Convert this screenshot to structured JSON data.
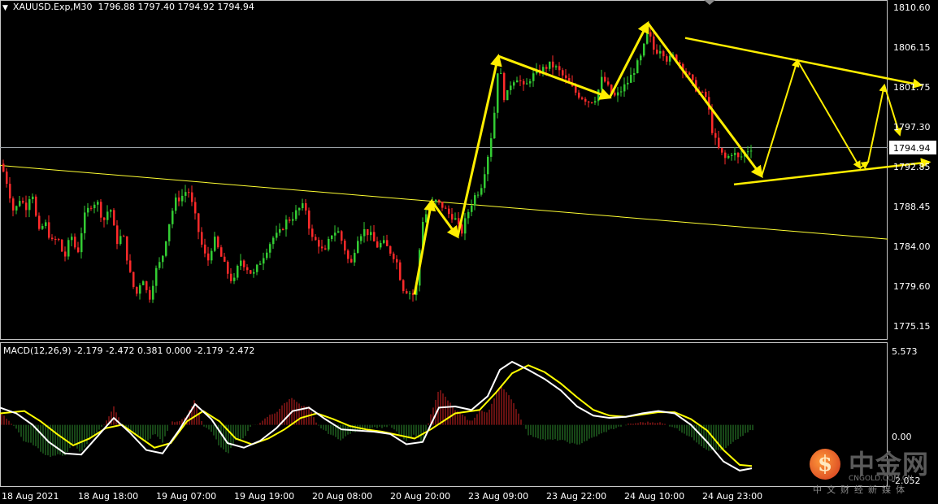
{
  "header": {
    "collapse_icon": "triangle-down-icon",
    "symbol_info": "XAUUSD.Exp,M30",
    "ohlc": "1796.88 1797.40 1794.92 1794.94"
  },
  "macd_header": {
    "label": "MACD(12,26,9) -2.179 -2.472 0.381 0.000 -2.179 -2.472"
  },
  "price_axis": {
    "ticks": [
      "1810.60",
      "1806.15",
      "1801.75",
      "1797.30",
      "1792.85",
      "1788.45",
      "1784.00",
      "1779.60",
      "1775.15"
    ],
    "current_price": "1794.94"
  },
  "macd_axis": {
    "ticks": [
      "5.573",
      "0.00",
      "-2.052"
    ]
  },
  "time_axis": {
    "labels": [
      "18 Aug 2021",
      "18 Aug 18:00",
      "19 Aug 07:00",
      "19 Aug 19:00",
      "20 Aug 08:00",
      "20 Aug 20:00",
      "23 Aug 09:00",
      "23 Aug 22:00",
      "24 Aug 10:00",
      "24 Aug 23:00"
    ]
  },
  "colors": {
    "background": "#000000",
    "bull_candle": "#33cc33",
    "bear_candle": "#ff2a2a",
    "trendline": "#ffff33",
    "annotation": "#ffee00",
    "macd_line": "#ffffff",
    "signal_line": "#ffff00",
    "hist_up": "#cc2222",
    "hist_down": "#2e8b2e"
  },
  "chart_data": {
    "type": "candlestick",
    "symbol": "XAUUSD.Exp",
    "timeframe": "M30",
    "last": {
      "open": 1796.88,
      "high": 1797.4,
      "low": 1794.92,
      "close": 1794.94
    },
    "ylim": [
      1773.5,
      1812.0
    ],
    "path": [
      [
        0,
        1793.0
      ],
      [
        8,
        1790.5
      ],
      [
        16,
        1787.0
      ],
      [
        24,
        1789.0
      ],
      [
        30,
        1787.5
      ],
      [
        38,
        1790.0
      ],
      [
        46,
        1784.5
      ],
      [
        54,
        1786.0
      ],
      [
        62,
        1783.5
      ],
      [
        70,
        1784.0
      ],
      [
        78,
        1781.5
      ],
      [
        86,
        1784.5
      ],
      [
        94,
        1782.0
      ],
      [
        102,
        1786.5
      ],
      [
        110,
        1788.0
      ],
      [
        118,
        1788.5
      ],
      [
        126,
        1786.0
      ],
      [
        134,
        1788.0
      ],
      [
        142,
        1783.5
      ],
      [
        150,
        1784.5
      ],
      [
        158,
        1780.0
      ],
      [
        166,
        1777.0
      ],
      [
        174,
        1779.5
      ],
      [
        182,
        1776.5
      ],
      [
        190,
        1780.0
      ],
      [
        198,
        1781.5
      ],
      [
        206,
        1785.5
      ],
      [
        214,
        1788.5
      ],
      [
        222,
        1789.0
      ],
      [
        230,
        1790.0
      ],
      [
        238,
        1787.0
      ],
      [
        246,
        1783.5
      ],
      [
        254,
        1781.0
      ],
      [
        262,
        1784.0
      ],
      [
        270,
        1782.0
      ],
      [
        278,
        1780.0
      ],
      [
        286,
        1778.5
      ],
      [
        294,
        1781.5
      ],
      [
        302,
        1780.5
      ],
      [
        310,
        1779.5
      ],
      [
        318,
        1781.0
      ],
      [
        326,
        1782.5
      ],
      [
        334,
        1784.0
      ],
      [
        342,
        1784.5
      ],
      [
        350,
        1786.0
      ],
      [
        358,
        1786.5
      ],
      [
        366,
        1787.5
      ],
      [
        374,
        1788.0
      ],
      [
        382,
        1784.0
      ],
      [
        390,
        1783.5
      ],
      [
        398,
        1782.0
      ],
      [
        406,
        1784.5
      ],
      [
        414,
        1785.0
      ],
      [
        422,
        1783.0
      ],
      [
        430,
        1780.5
      ],
      [
        438,
        1784.0
      ],
      [
        446,
        1785.0
      ],
      [
        454,
        1784.5
      ],
      [
        462,
        1783.0
      ],
      [
        470,
        1783.5
      ],
      [
        478,
        1782.5
      ],
      [
        486,
        1781.5
      ],
      [
        494,
        1778.0
      ],
      [
        502,
        1777.5
      ],
      [
        510,
        1777.0
      ],
      [
        518,
        1786.0
      ],
      [
        526,
        1787.5
      ],
      [
        534,
        1788.5
      ],
      [
        542,
        1788.0
      ],
      [
        550,
        1787.0
      ],
      [
        558,
        1786.5
      ],
      [
        566,
        1784.5
      ],
      [
        574,
        1787.0
      ],
      [
        582,
        1789.0
      ],
      [
        590,
        1790.0
      ],
      [
        598,
        1793.5
      ],
      [
        606,
        1798.0
      ],
      [
        612,
        1805.5
      ],
      [
        620,
        1800.5
      ],
      [
        628,
        1803.0
      ],
      [
        636,
        1803.5
      ],
      [
        644,
        1802.0
      ],
      [
        652,
        1803.5
      ],
      [
        660,
        1804.0
      ],
      [
        668,
        1804.5
      ],
      [
        676,
        1805.0
      ],
      [
        684,
        1804.5
      ],
      [
        692,
        1803.5
      ],
      [
        700,
        1802.5
      ],
      [
        708,
        1801.5
      ],
      [
        716,
        1801.0
      ],
      [
        724,
        1800.5
      ],
      [
        732,
        1801.0
      ],
      [
        740,
        1803.5
      ],
      [
        748,
        1802.0
      ],
      [
        756,
        1801.0
      ],
      [
        764,
        1802.0
      ],
      [
        772,
        1803.0
      ],
      [
        780,
        1804.5
      ],
      [
        788,
        1806.0
      ],
      [
        796,
        1809.0
      ],
      [
        804,
        1806.5
      ],
      [
        812,
        1807.0
      ],
      [
        820,
        1805.5
      ],
      [
        828,
        1806.0
      ],
      [
        836,
        1805.0
      ],
      [
        844,
        1804.0
      ],
      [
        852,
        1802.5
      ],
      [
        860,
        1801.5
      ],
      [
        868,
        1801.0
      ],
      [
        876,
        1796.5
      ],
      [
        884,
        1794.5
      ],
      [
        892,
        1793.5
      ],
      [
        900,
        1794.5
      ],
      [
        908,
        1793.5
      ],
      [
        916,
        1794.5
      ],
      [
        924,
        1795.0
      ]
    ],
    "macd_path": [
      [
        0,
        1.5
      ],
      [
        20,
        1.0
      ],
      [
        40,
        0.0
      ],
      [
        60,
        -1.5
      ],
      [
        80,
        -2.5
      ],
      [
        100,
        -2.6
      ],
      [
        120,
        -1.0
      ],
      [
        140,
        0.6
      ],
      [
        160,
        -0.7
      ],
      [
        180,
        -2.2
      ],
      [
        200,
        -2.5
      ],
      [
        220,
        -0.5
      ],
      [
        240,
        1.8
      ],
      [
        260,
        0.5
      ],
      [
        280,
        -1.6
      ],
      [
        300,
        -2.0
      ],
      [
        320,
        -1.4
      ],
      [
        340,
        -0.3
      ],
      [
        360,
        1.2
      ],
      [
        380,
        1.5
      ],
      [
        400,
        0.5
      ],
      [
        420,
        -0.4
      ],
      [
        440,
        -0.5
      ],
      [
        460,
        -0.6
      ],
      [
        480,
        -0.8
      ],
      [
        500,
        -1.7
      ],
      [
        520,
        -1.5
      ],
      [
        540,
        1.5
      ],
      [
        560,
        1.6
      ],
      [
        580,
        1.3
      ],
      [
        600,
        2.5
      ],
      [
        615,
        4.8
      ],
      [
        630,
        5.5
      ],
      [
        650,
        4.8
      ],
      [
        670,
        4.0
      ],
      [
        690,
        3.0
      ],
      [
        710,
        1.6
      ],
      [
        730,
        0.8
      ],
      [
        750,
        0.6
      ],
      [
        770,
        0.7
      ],
      [
        790,
        1.0
      ],
      [
        810,
        1.2
      ],
      [
        830,
        1.0
      ],
      [
        850,
        0.0
      ],
      [
        870,
        -1.5
      ],
      [
        890,
        -3.2
      ],
      [
        910,
        -4.0
      ],
      [
        925,
        -3.8
      ]
    ],
    "signal_path": [
      [
        0,
        1.0
      ],
      [
        30,
        1.2
      ],
      [
        50,
        0.3
      ],
      [
        70,
        -0.8
      ],
      [
        90,
        -1.8
      ],
      [
        110,
        -1.2
      ],
      [
        130,
        -0.3
      ],
      [
        150,
        0.0
      ],
      [
        170,
        -1.0
      ],
      [
        190,
        -2.0
      ],
      [
        210,
        -1.6
      ],
      [
        230,
        0.3
      ],
      [
        250,
        1.2
      ],
      [
        270,
        0.3
      ],
      [
        290,
        -1.2
      ],
      [
        310,
        -1.7
      ],
      [
        330,
        -1.2
      ],
      [
        350,
        -0.4
      ],
      [
        370,
        0.6
      ],
      [
        390,
        1.0
      ],
      [
        410,
        0.5
      ],
      [
        430,
        -0.1
      ],
      [
        450,
        -0.4
      ],
      [
        470,
        -0.6
      ],
      [
        490,
        -0.9
      ],
      [
        510,
        -1.2
      ],
      [
        530,
        -0.4
      ],
      [
        560,
        1.0
      ],
      [
        590,
        1.3
      ],
      [
        610,
        2.8
      ],
      [
        630,
        4.5
      ],
      [
        650,
        5.2
      ],
      [
        670,
        4.6
      ],
      [
        690,
        3.6
      ],
      [
        710,
        2.4
      ],
      [
        730,
        1.3
      ],
      [
        750,
        0.8
      ],
      [
        770,
        0.7
      ],
      [
        790,
        0.9
      ],
      [
        810,
        1.1
      ],
      [
        830,
        1.1
      ],
      [
        850,
        0.5
      ],
      [
        870,
        -0.5
      ],
      [
        890,
        -2.2
      ],
      [
        910,
        -3.5
      ],
      [
        925,
        -3.6
      ]
    ],
    "macd_ylim": [
      -5.0,
      6.5
    ],
    "horizontal_line": 1794.94,
    "trendlines": [
      {
        "x1": 0,
        "y1": 1792.8,
        "x2": 1092,
        "y2": 1783.9
      }
    ],
    "annotation_polyline_1": [
      [
        510,
        1777.2
      ],
      [
        531,
        1788.5
      ],
      [
        563,
        1784.2
      ],
      [
        613,
        1806.0
      ],
      [
        750,
        1801.0
      ],
      [
        797,
        1810.0
      ],
      [
        937,
        1791.5
      ],
      [
        981,
        1805.5
      ],
      [
        1058,
        1792.5
      ],
      [
        1068,
        1793.2
      ],
      [
        1088,
        1802.5
      ],
      [
        1107,
        1796.5
      ]
    ],
    "annotation_lines": [
      {
        "x1": 843,
        "y1": 1808.2,
        "x2": 1133,
        "y2": 1802.5
      },
      {
        "x1": 903,
        "y1": 1790.5,
        "x2": 1143,
        "y2": 1793.2
      }
    ]
  }
}
